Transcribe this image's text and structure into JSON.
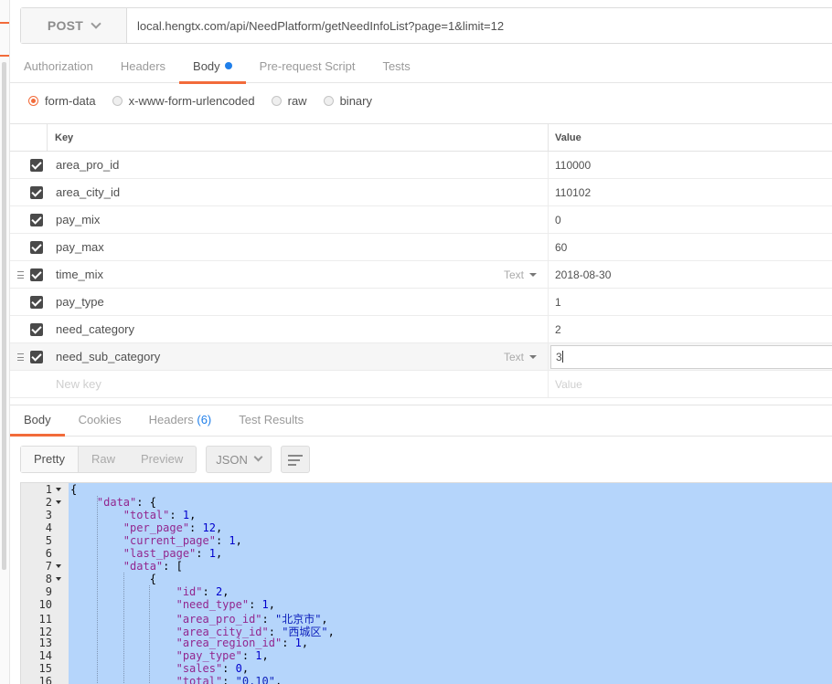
{
  "request": {
    "method": "POST",
    "url": "local.hengtx.com/api/NeedPlatform/getNeedInfoList?page=1&limit=12"
  },
  "request_tabs": [
    {
      "label": "Authorization",
      "active": false
    },
    {
      "label": "Headers",
      "active": false
    },
    {
      "label": "Body",
      "active": true,
      "dot": true
    },
    {
      "label": "Pre-request Script",
      "active": false
    },
    {
      "label": "Tests",
      "active": false
    }
  ],
  "body_types": {
    "form_data": "form-data",
    "urlencoded": "x-www-form-urlencoded",
    "raw": "raw",
    "binary": "binary",
    "selected": "form-data"
  },
  "params": {
    "key_header": "Key",
    "value_header": "Value",
    "rows": [
      {
        "key": "area_pro_id",
        "value": "110000",
        "checked": true
      },
      {
        "key": "area_city_id",
        "value": "110102",
        "checked": true
      },
      {
        "key": "pay_mix",
        "value": "0",
        "checked": true
      },
      {
        "key": "pay_max",
        "value": "60",
        "checked": true
      },
      {
        "key": "time_mix",
        "value": "2018-08-30",
        "checked": true,
        "type": "Text"
      },
      {
        "key": "pay_type",
        "value": "1",
        "checked": true
      },
      {
        "key": "need_category",
        "value": "2",
        "checked": true
      },
      {
        "key": "need_sub_category",
        "value": "3",
        "checked": true,
        "type": "Text"
      }
    ],
    "new_key_placeholder": "New key",
    "new_value_placeholder": "Value"
  },
  "response_tabs": {
    "body": "Body",
    "cookies": "Cookies",
    "headers": "Headers",
    "headers_count": "(6)",
    "test_results": "Test Results"
  },
  "view_modes": {
    "pretty": "Pretty",
    "raw": "Raw",
    "preview": "Preview",
    "format": "JSON"
  },
  "response_body": {
    "line_numbers": [
      "1",
      "2",
      "3",
      "4",
      "5",
      "6",
      "7",
      "8",
      "9",
      "10",
      "11",
      "12",
      "13",
      "14",
      "15",
      "16"
    ],
    "lines": [
      "{",
      "    \"data\": {",
      "        \"total\": 1,",
      "        \"per_page\": 12,",
      "        \"current_page\": 1,",
      "        \"last_page\": 1,",
      "        \"data\": [",
      "            {",
      "                \"id\": 2,",
      "                \"need_type\": 1,",
      "                \"area_pro_id\": \"北京市\",",
      "                \"area_city_id\": \"西城区\",",
      "                \"area_region_id\": 1,",
      "                \"pay_type\": 1,",
      "                \"sales\": 0,",
      "                \"total\": \"0.10\","
    ]
  },
  "colors": {
    "accent": "#f26b3a",
    "link": "#1f7fea",
    "selection": "#b5d5fb"
  }
}
